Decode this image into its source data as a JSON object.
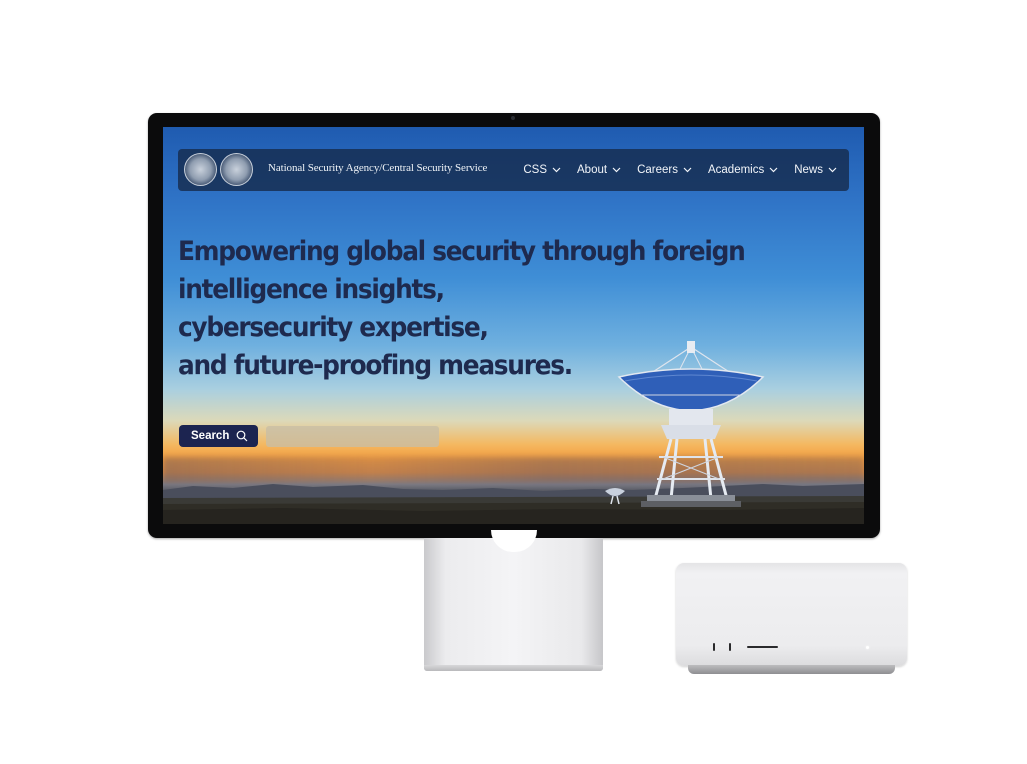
{
  "site": {
    "name": "National Security Agency/Central Security Service",
    "seal_icons": [
      "nsa-seal-icon",
      "css-seal-icon"
    ]
  },
  "nav": {
    "items": [
      {
        "label": "CSS"
      },
      {
        "label": "About"
      },
      {
        "label": "Careers"
      },
      {
        "label": "Academics"
      },
      {
        "label": "News"
      }
    ]
  },
  "hero": {
    "lines": [
      "Empowering global security through foreign",
      "intelligence insights,",
      "cybersecurity expertise,",
      "and future-proofing measures."
    ]
  },
  "search": {
    "button_label": "Search",
    "placeholder": "",
    "value": ""
  },
  "colors": {
    "navbar": "#162c4e",
    "hero_text": "#1e2a4e",
    "search_button": "#1c2450",
    "search_field": "#c8bea5"
  }
}
